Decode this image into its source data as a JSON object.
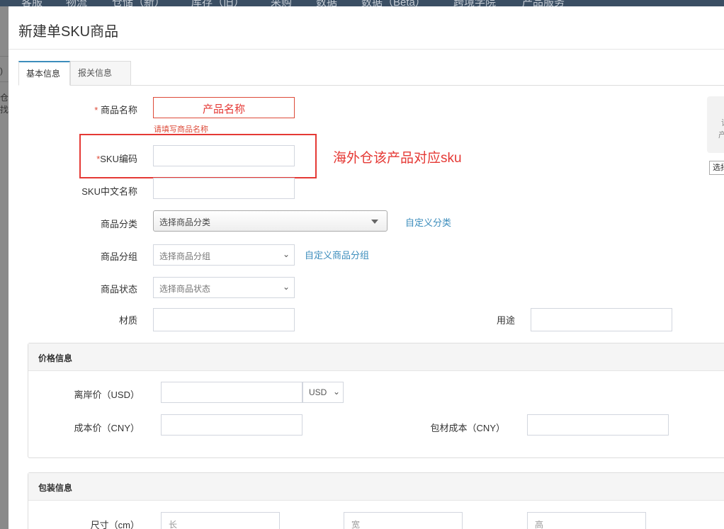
{
  "background": {
    "nav": [
      "客服",
      "物流",
      "仓储（新）",
      "库存（旧）",
      "采购",
      "数据",
      "数据（Beta）",
      "跨境学院",
      "产品服务"
    ],
    "side_fragments": [
      ")",
      "仓找"
    ]
  },
  "modal": {
    "title": "新建单SKU商品",
    "tabs": [
      {
        "label": "基本信息",
        "active": true
      },
      {
        "label": "报关信息",
        "active": false
      }
    ]
  },
  "form": {
    "name": {
      "label": "商品名称",
      "required_mark": "*",
      "value": "产品名称",
      "error": "请填写商品名称"
    },
    "sku": {
      "label": "SKU编码",
      "required_mark": "*",
      "value": ""
    },
    "sku_cn_name": {
      "label": "SKU中文名称",
      "value": ""
    },
    "category": {
      "label": "商品分类",
      "placeholder": "选择商品分类",
      "custom_link": "自定义分类"
    },
    "group": {
      "label": "商品分组",
      "placeholder": "选择商品分组",
      "custom_link": "自定义商品分组"
    },
    "status": {
      "label": "商品状态",
      "placeholder": "选择商品状态"
    },
    "material": {
      "label": "材质",
      "value": ""
    },
    "usage": {
      "label": "用途",
      "value": ""
    }
  },
  "annotation": {
    "text": "海外仓该产品对应sku"
  },
  "right_panel": {
    "card_chars": [
      "请",
      "产"
    ],
    "button_label": "选择"
  },
  "price_section": {
    "title": "价格信息",
    "offshore_price_label": "离岸价（USD）",
    "currency": "USD",
    "cost_price_label": "成本价（CNY）",
    "packing_cost_label": "包材成本（CNY）"
  },
  "package_section": {
    "title": "包装信息",
    "size_label": "尺寸（cm）",
    "length_ph": "长",
    "width_ph": "宽",
    "height_ph": "高"
  },
  "colors": {
    "accent": "#3c8dbc",
    "error": "#dd4b39",
    "annotation": "#e53935"
  }
}
